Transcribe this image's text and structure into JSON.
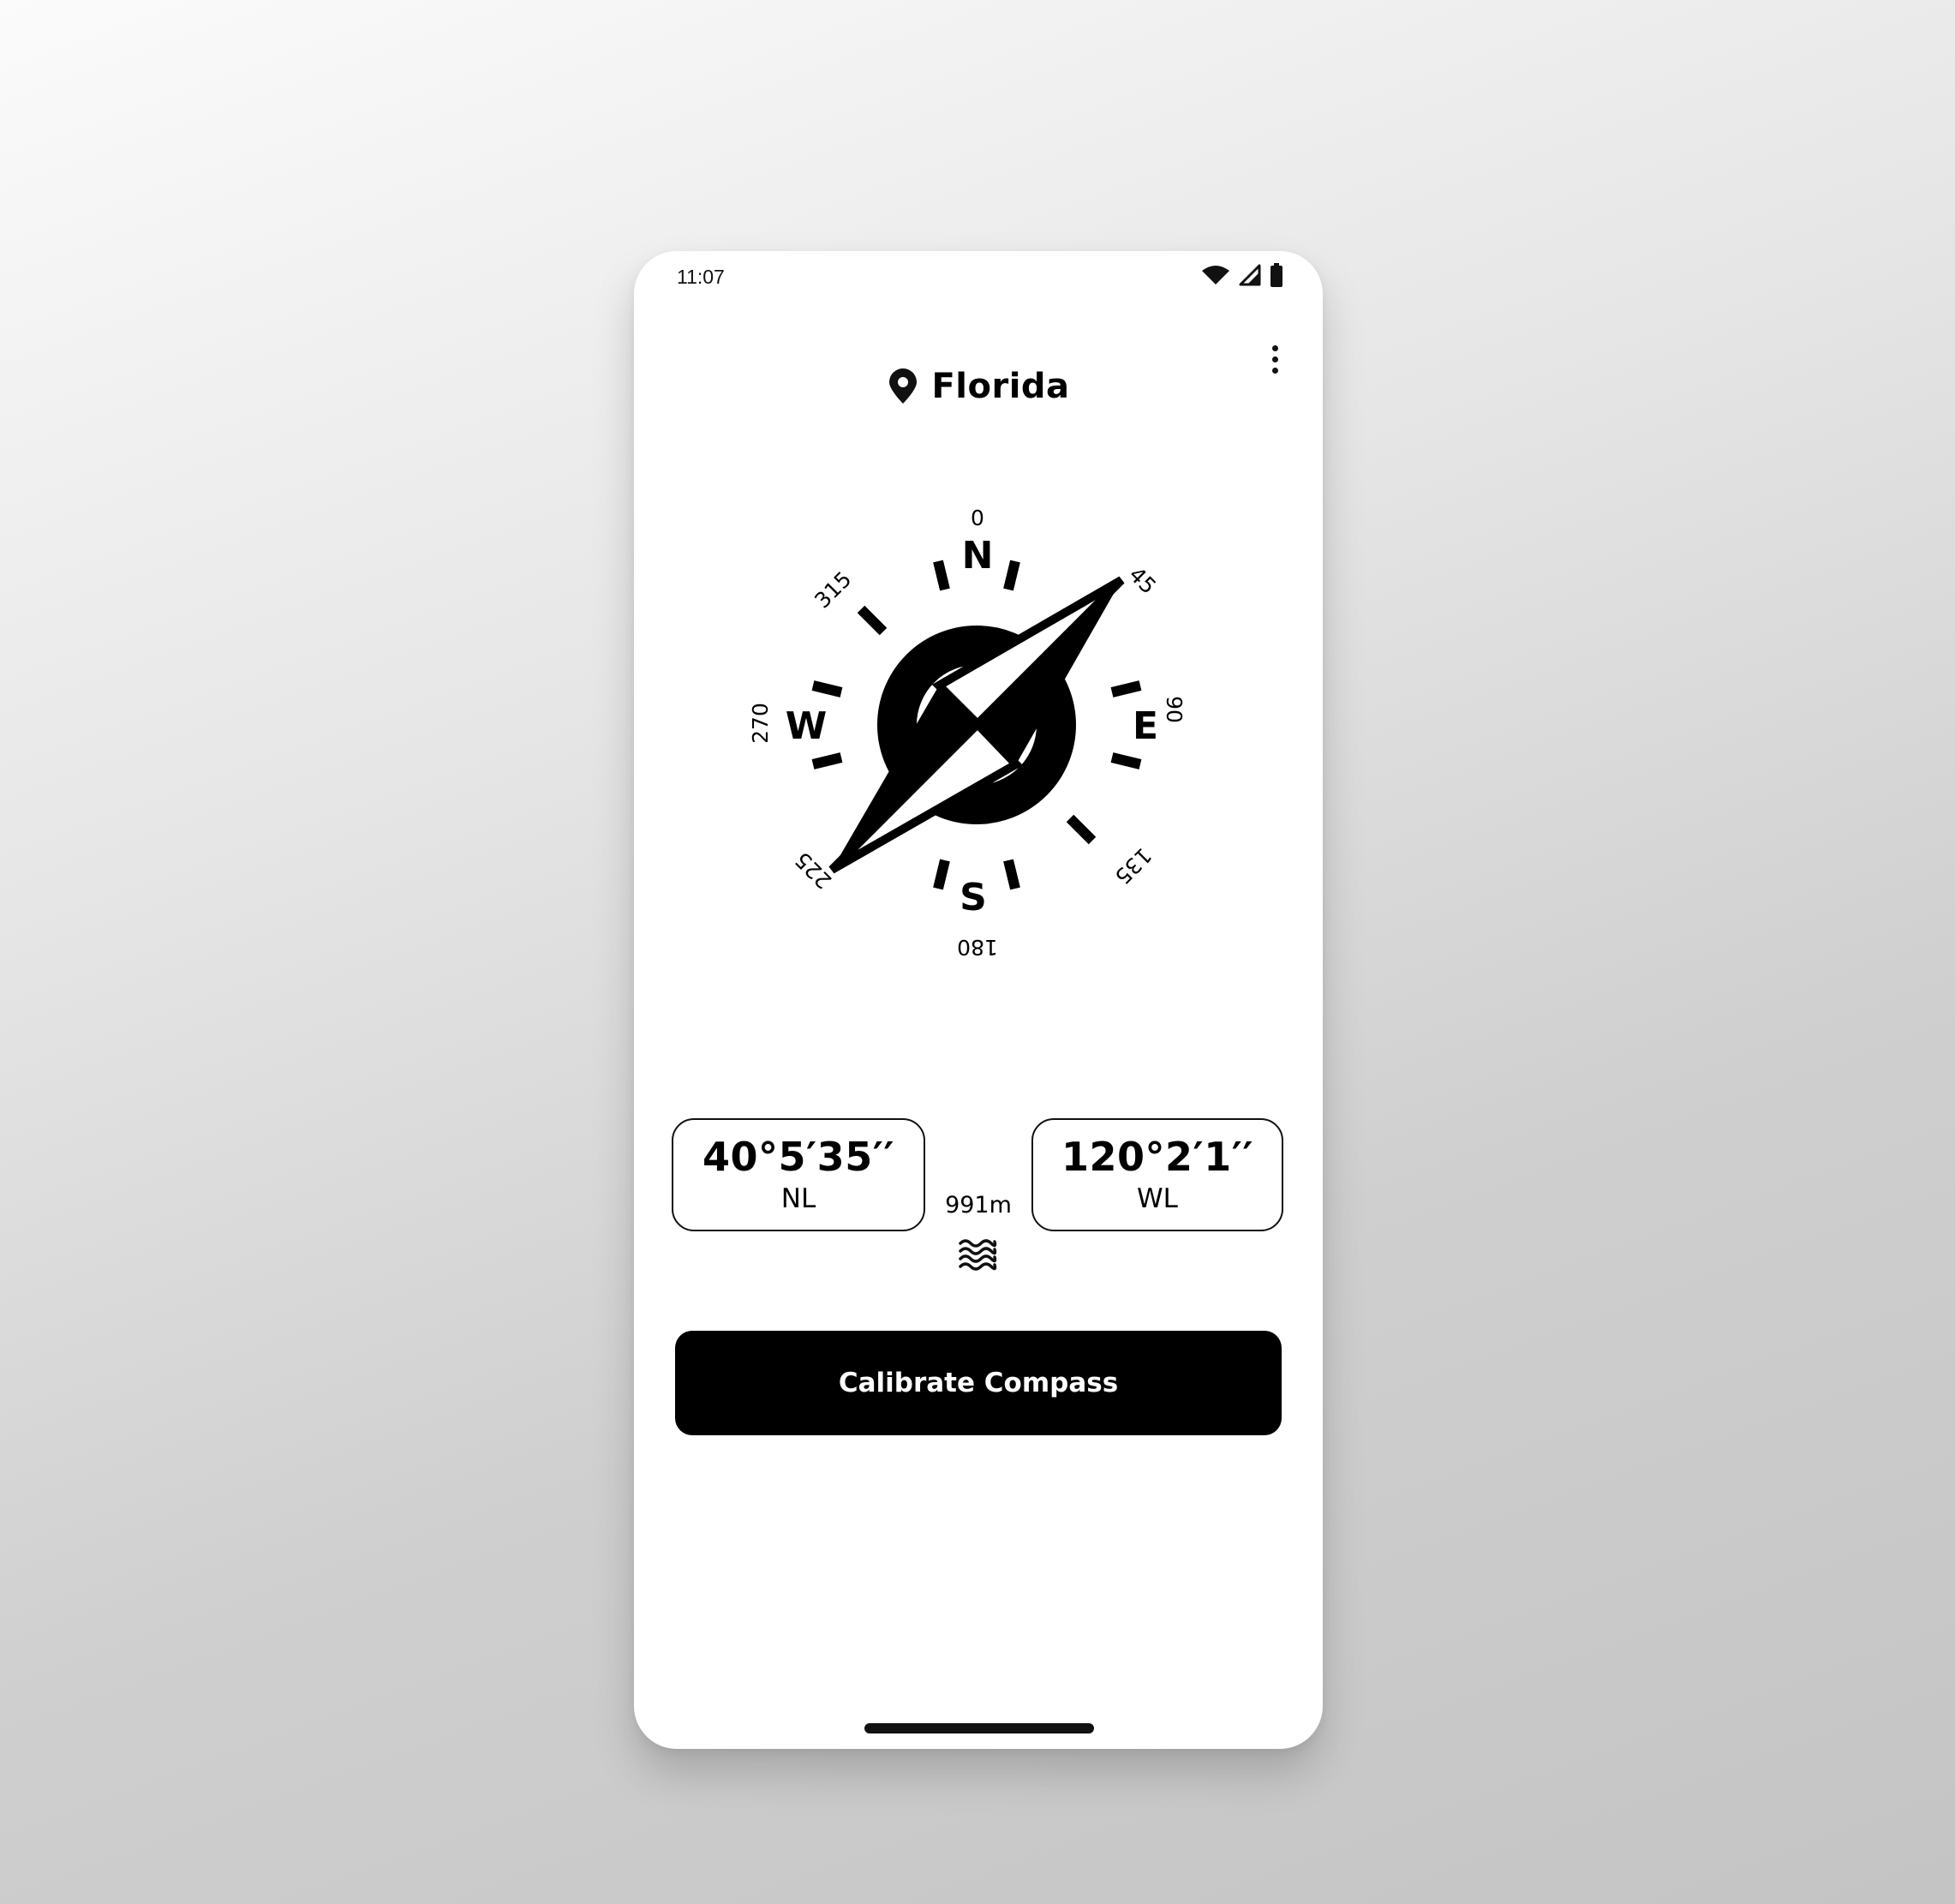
{
  "status_bar": {
    "time": "11:07",
    "icons": [
      "wifi-icon",
      "signal-icon",
      "battery-icon"
    ]
  },
  "header": {
    "location": "Florida",
    "location_icon": "location-pin-icon",
    "menu_icon": "more-vertical-icon"
  },
  "compass": {
    "cardinals": {
      "north": "N",
      "east": "E",
      "south": "S",
      "west": "W"
    },
    "degrees": {
      "d0": "0",
      "d45": "45",
      "d90": "90",
      "d135": "135",
      "d180": "180",
      "d225": "225",
      "d270": "270",
      "d315": "315"
    },
    "needle_heading_deg": 45
  },
  "coordinates": {
    "latitude": {
      "value": "40°5′35′′",
      "direction": "NL"
    },
    "longitude": {
      "value": "120°2′1′′",
      "direction": "WL"
    },
    "altitude": "991m",
    "altitude_icon": "waves-icon"
  },
  "actions": {
    "calibrate_label": "Calibrate Compass"
  },
  "colors": {
    "primary": "#000000",
    "surface": "#ffffff"
  }
}
